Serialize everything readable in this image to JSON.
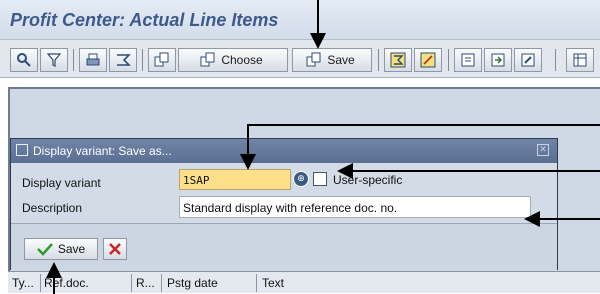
{
  "window": {
    "title": "Profit Center: Actual Line Items"
  },
  "toolbar": {
    "choose_label": "Choose",
    "save_label": "Save",
    "icons": [
      "details-icon",
      "filter-icon",
      "print-icon",
      "sum-icon",
      "choose-layout-icon",
      "save-layout-icon",
      "total-icon",
      "subtotal-icon",
      "export-icon",
      "send-icon",
      "edit-icon",
      "more-icon"
    ]
  },
  "dialog": {
    "title": "Display variant: Save as...",
    "variant_label": "Display variant",
    "variant_value": "1SAP",
    "user_specific_label": "User-specific",
    "user_specific_checked": false,
    "description_label": "Description",
    "description_value": "Standard display with reference doc. no.",
    "save_label": "Save"
  },
  "grid": {
    "columns": [
      "Ty...",
      "Ref.doc.",
      "R...",
      "Pstg date",
      "Text"
    ]
  },
  "colors": {
    "title_text": "#3d5a8c",
    "dialog_header": "#5a6f92",
    "variant_field_bg": "#ffe08a",
    "check_icon": "#2f9b2f",
    "cancel_icon": "#c62828"
  }
}
